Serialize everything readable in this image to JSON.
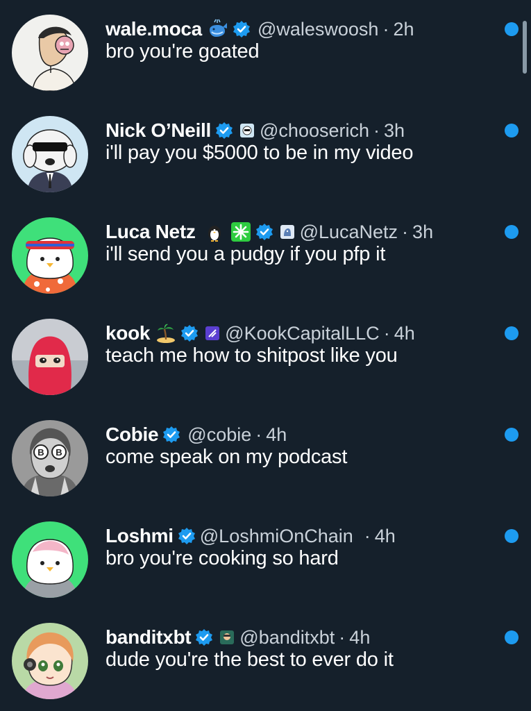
{
  "colors": {
    "background": "#15202b",
    "text": "#ffffff",
    "secondary_text": "#c9d1d9",
    "unread_dot": "#1d9bf0",
    "verified_badge": "#1d9bf0"
  },
  "separator": "·",
  "messages": [
    {
      "name": "wale.moca",
      "handle": "@waleswoosh",
      "time": "2h",
      "text": "bro you're goated",
      "emoji": "whale-emoji-icon",
      "unread": true
    },
    {
      "name": "Nick O’Neill",
      "handle": "@chooserich",
      "time": "3h",
      "text": "i'll pay you $5000 to be in my video",
      "emoji": "",
      "unread": true
    },
    {
      "name": "Luca Netz",
      "handle": "@LucaNetz",
      "time": "3h",
      "text": "i'll send you a pudgy if you pfp it",
      "emoji": "penguin-emoji-icon",
      "unread": true
    },
    {
      "name": "kook",
      "handle": "@KookCapitalLLC",
      "time": "4h",
      "text": "teach me how to shitpost like you",
      "emoji": "island-emoji-icon",
      "unread": true
    },
    {
      "name": "Cobie",
      "handle": "@cobie",
      "time": "4h",
      "text": "come speak on my podcast",
      "emoji": "",
      "unread": true
    },
    {
      "name": "Loshmi",
      "handle": "@LoshmiOnChain",
      "time": "4h",
      "text": "bro you're cooking so hard",
      "emoji": "",
      "unread": true
    },
    {
      "name": "banditxbt",
      "handle": "@banditxbt",
      "time": "4h",
      "text": "dude you're the best to ever do it",
      "emoji": "",
      "unread": true
    }
  ]
}
